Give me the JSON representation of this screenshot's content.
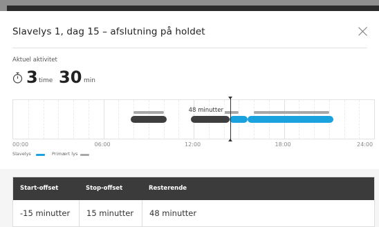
{
  "dialog": {
    "title": "Slavelys 1, dag 15 – afslutning på holdet",
    "close_icon": "close-icon"
  },
  "activity": {
    "label": "Aktuel aktivitet",
    "icon": "stopwatch-icon",
    "hours": "3",
    "hours_unit": "time",
    "minutes": "30",
    "minutes_unit": "min"
  },
  "timeline": {
    "range_hours": [
      0,
      24
    ],
    "cursor_label": "48 minutter",
    "cursor_hour": 14.42,
    "tick_labels": [
      "00:00",
      "06:00",
      "12:00",
      "18:00",
      "24:00"
    ],
    "slavelys_segments": [
      {
        "start": 7.8,
        "end": 10.2,
        "status": "past"
      },
      {
        "start": 11.8,
        "end": 14.4,
        "status": "past"
      },
      {
        "start": 14.4,
        "end": 15.6,
        "status": "active"
      },
      {
        "start": 15.6,
        "end": 21.3,
        "status": "active"
      }
    ],
    "primaert_lys_segments": [
      {
        "start": 8.0,
        "end": 10.0
      },
      {
        "start": 12.0,
        "end": 15.0
      },
      {
        "start": 16.0,
        "end": 21.0
      }
    ],
    "colors": {
      "past": "#3e3e3e",
      "active": "#1aa2df",
      "primaert": "#a8a8a8"
    }
  },
  "legend": {
    "slavelys_label": "Slavelys",
    "slavelys_color": "#1aa2df",
    "primaert_label": "Primært lys",
    "primaert_color": "#a8a8a8"
  },
  "table": {
    "headers": [
      "Start-offset",
      "Stop-offset",
      "Resterende"
    ],
    "row": [
      "-15 minutter",
      "15 minutter",
      "48 minutter"
    ]
  }
}
